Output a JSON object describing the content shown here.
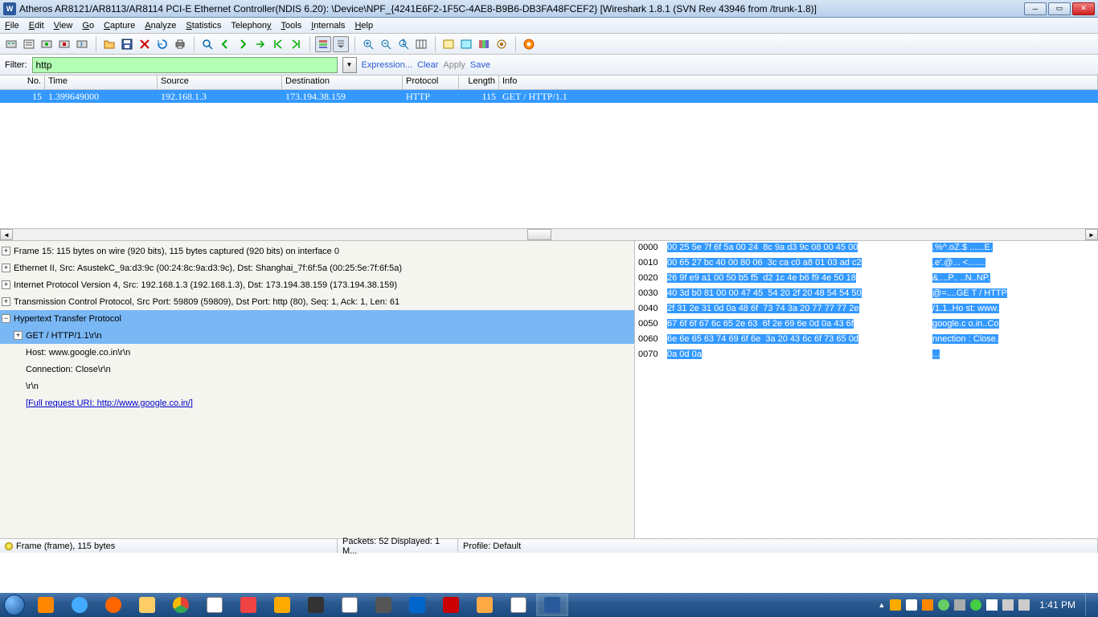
{
  "window": {
    "title": "Atheros AR8121/AR8113/AR8114 PCI-E Ethernet Controller(NDIS 6.20): \\Device\\NPF_{4241E6F2-1F5C-4AE8-B9B6-DB3FA48FCEF2}   [Wireshark 1.8.1  (SVN Rev 43946 from /trunk-1.8)]"
  },
  "menu": {
    "file": "File",
    "edit": "Edit",
    "view": "View",
    "go": "Go",
    "capture": "Capture",
    "analyze": "Analyze",
    "statistics": "Statistics",
    "telephony": "Telephony",
    "tools": "Tools",
    "internals": "Internals",
    "help": "Help"
  },
  "filter": {
    "label": "Filter:",
    "value": "http",
    "expression": "Expression...",
    "clear": "Clear",
    "apply": "Apply",
    "save": "Save"
  },
  "columns": {
    "no": "No.",
    "time": "Time",
    "source": "Source",
    "destination": "Destination",
    "protocol": "Protocol",
    "length": "Length",
    "info": "Info"
  },
  "rows": [
    {
      "no": "15",
      "time": "1.399649000",
      "source": "192.168.1.3",
      "destination": "173.194.38.159",
      "protocol": "HTTP",
      "length": "115",
      "info": "GET / HTTP/1.1"
    }
  ],
  "details": {
    "frame": "Frame 15: 115 bytes on wire (920 bits), 115 bytes captured (920 bits) on interface 0",
    "eth": "Ethernet II, Src: AsustekC_9a:d3:9c (00:24:8c:9a:d3:9c), Dst: Shanghai_7f:6f:5a (00:25:5e:7f:6f:5a)",
    "ip": "Internet Protocol Version 4, Src: 192.168.1.3 (192.168.1.3), Dst: 173.194.38.159 (173.194.38.159)",
    "tcp": "Transmission Control Protocol, Src Port: 59809 (59809), Dst Port: http (80), Seq: 1, Ack: 1, Len: 61",
    "http": "Hypertext Transfer Protocol",
    "get": "GET / HTTP/1.1\\r\\n",
    "host": "Host: www.google.co.in\\r\\n",
    "conn": "Connection: Close\\r\\n",
    "crlf": "\\r\\n",
    "uri": "[Full request URI: http://www.google.co.in/]"
  },
  "hex": [
    {
      "off": "0000",
      "b": "00 25 5e 7f 6f 5a 00 24  8c 9a d3 9c 08 00 45 00",
      "a": ".%^.oZ.$ ......E.",
      "hl": true
    },
    {
      "off": "0010",
      "b": "00 65 27 bc 40 00 80 06  3c ca c0 a8 01 03 ad c2",
      "a": ".e'.@... <.......",
      "hl": true
    },
    {
      "off": "0020",
      "b": "26 9f e9 a1 00 50 b5 f5  d2 1c 4e b6 f9 4e 50 18",
      "a": "&....P.. ..N..NP.",
      "hl": true
    },
    {
      "off": "0030",
      "b": "40 3d b0 81 00 00 47 45  54 20 2f 20 48 54 54 50",
      "a": "@=....GE T / HTTP",
      "hl": true
    },
    {
      "off": "0040",
      "b": "2f 31 2e 31 0d 0a 48 6f  73 74 3a 20 77 77 77 2e",
      "a": "/1.1..Ho st: www.",
      "hl": true
    },
    {
      "off": "0050",
      "b": "67 6f 6f 67 6c 65 2e 63  6f 2e 69 6e 0d 0a 43 6f",
      "a": "google.c o.in..Co",
      "hl": true
    },
    {
      "off": "0060",
      "b": "6e 6e 65 63 74 69 6f 6e  3a 20 43 6c 6f 73 65 0d",
      "a": "nnection : Close.",
      "hl": true
    },
    {
      "off": "0070",
      "b": "0a 0d 0a",
      "a": "...",
      "hl": true
    }
  ],
  "status": {
    "frame": "Frame (frame), 115 bytes",
    "packets": "Packets: 52 Displayed: 1 M...",
    "profile": "Profile: Default"
  },
  "taskbar": {
    "clock": "1:41 PM"
  }
}
